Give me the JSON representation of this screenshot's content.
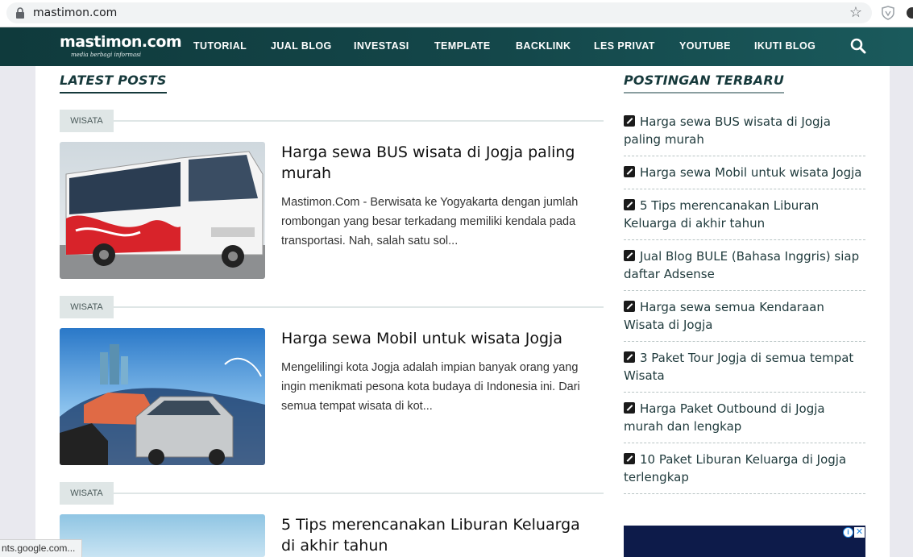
{
  "browser": {
    "url": "mastimon.com",
    "status_url": "nts.google.com..."
  },
  "site": {
    "logo_text": "mastimon.com",
    "logo_tagline": "media berbagi informasi",
    "nav": [
      "TUTORIAL",
      "JUAL BLOG",
      "INVESTASI",
      "TEMPLATE",
      "BACKLINK",
      "LES PRIVAT",
      "YOUTUBE",
      "IKUTI BLOG"
    ]
  },
  "main": {
    "section_title": "LATEST POSTS",
    "posts": [
      {
        "category": "WISATA",
        "title": "Harga sewa BUS wisata di Jogja paling murah",
        "excerpt": "Mastimon.Com - Berwisata ke Yogyakarta dengan jumlah rombongan yang besar terkadang memiliki kendala pada transportasi. Nah, salah satu sol..."
      },
      {
        "category": "WISATA",
        "title": "Harga sewa Mobil untuk wisata Jogja",
        "excerpt": "Mengelilingi kota Jogja adalah impian banyak orang yang ingin menikmati pesona kota budaya di Indonesia ini. Dari semua tempat wisata di kot..."
      },
      {
        "category": "WISATA",
        "title": "5 Tips merencanakan Liburan Keluarga di akhir tahun",
        "excerpt": ""
      }
    ]
  },
  "sidebar": {
    "title": "POSTINGAN TERBARU",
    "items": [
      "Harga sewa BUS wisata di Jogja paling murah",
      "Harga sewa Mobil untuk wisata Jogja",
      "5 Tips merencanakan Liburan Keluarga di akhir tahun",
      "Jual Blog BULE (Bahasa Inggris) siap daftar Adsense",
      "Harga sewa semua Kendaraan Wisata di Jogja",
      "3 Paket Tour Jogja di semua tempat Wisata",
      "Harga Paket Outbound di Jogja murah dan lengkap",
      "10 Paket Liburan Keluarga di Jogja terlengkap"
    ]
  },
  "ad": {
    "info_glyph": "i",
    "close_glyph": "✕"
  }
}
